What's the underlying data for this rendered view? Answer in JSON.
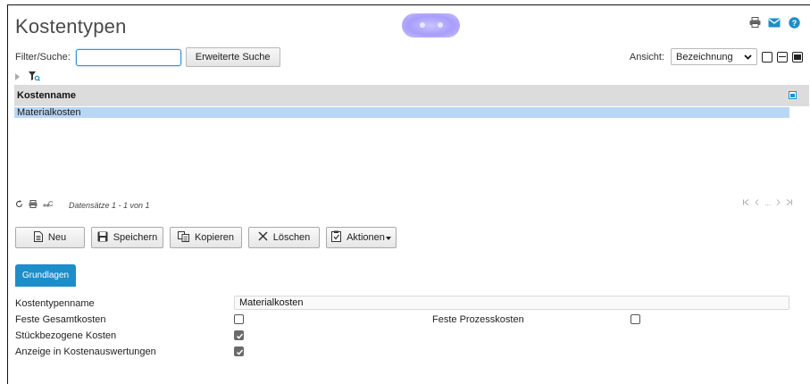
{
  "page": {
    "title": "Kostentypen"
  },
  "top_icons": [
    "printer-icon",
    "mail-icon",
    "help-icon"
  ],
  "filter": {
    "label": "Filter/Suche:",
    "value": "",
    "advanced_button": "Erweiterte Suche"
  },
  "view": {
    "label": "Ansicht:",
    "selected": "Bezeichnung"
  },
  "grid": {
    "column_header": "Kostenname",
    "rows": [
      "Materialkosten"
    ]
  },
  "pager": {
    "count_text": "Datensätze 1 - 1 von 1",
    "ellipsis": "..."
  },
  "toolbar": {
    "new_label": "Neu",
    "save_label": "Speichern",
    "copy_label": "Kopieren",
    "delete_label": "Löschen",
    "actions_label": "Aktionen"
  },
  "tabs": [
    {
      "label": "Grundlagen",
      "active": true
    }
  ],
  "form": {
    "name_label": "Kostentypenname",
    "name_value": "Materialkosten",
    "fixed_total_label": "Feste Gesamtkosten",
    "fixed_total_checked": false,
    "fixed_process_label": "Feste Prozesskosten",
    "fixed_process_checked": false,
    "per_piece_label": "Stückbezogene Kosten",
    "per_piece_checked": true,
    "show_in_reports_label": "Anzeige in Kostenauswertungen",
    "show_in_reports_checked": true
  },
  "colors": {
    "accent": "#1d8ec9",
    "selection": "#b9d6f4",
    "header_bg": "#dcdcdc"
  }
}
